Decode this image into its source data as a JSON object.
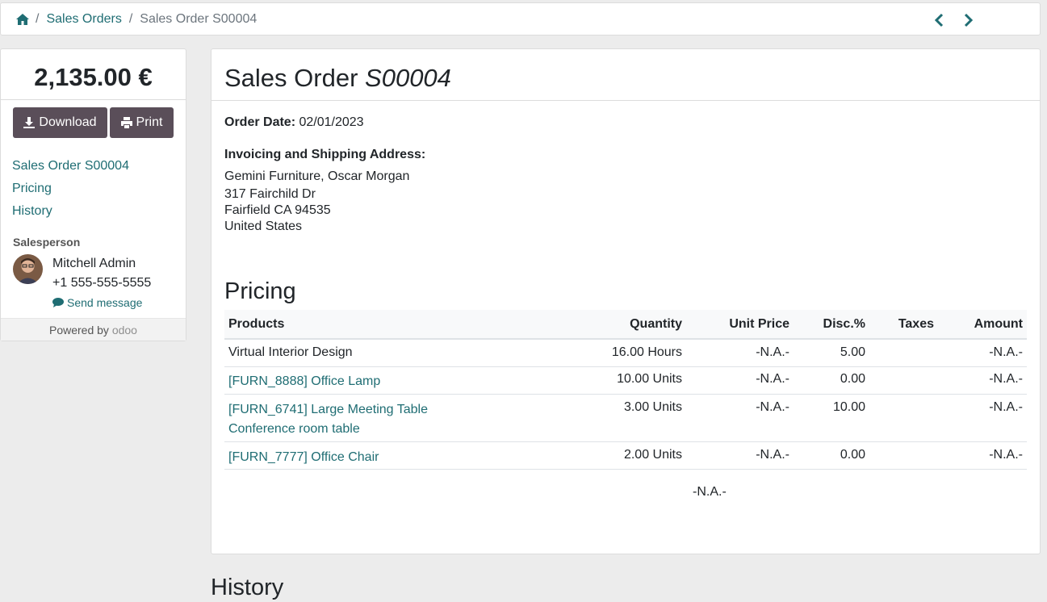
{
  "breadcrumb": {
    "home_icon": "home-icon",
    "separator": "/",
    "items": [
      "Sales Orders",
      "Sales Order S00004"
    ]
  },
  "pager": {
    "prev_icon": "chevron-left-icon",
    "next_icon": "chevron-right-icon"
  },
  "sidebar": {
    "total": "2,135.00 €",
    "download_label": "Download",
    "print_label": "Print",
    "nav": [
      "Sales Order S00004",
      "Pricing",
      "History"
    ],
    "salesperson_label": "Salesperson",
    "salesperson_name": "Mitchell Admin",
    "salesperson_phone": "+1 555-555-5555",
    "send_message": "Send message",
    "powered_by": "Powered by",
    "brand": "odoo"
  },
  "order": {
    "title_prefix": "Sales Order",
    "title_ref": "S00004",
    "date_label": "Order Date:",
    "date_value": "02/01/2023",
    "address_label": "Invoicing and Shipping Address:",
    "address_lines": [
      "Gemini Furniture, Oscar Morgan",
      "317 Fairchild Dr",
      "Fairfield CA 94535",
      "United States"
    ],
    "pricing_heading": "Pricing",
    "history_heading": "History"
  },
  "table": {
    "headers": [
      "Products",
      "Quantity",
      "Unit Price",
      "Disc.%",
      "Taxes",
      "Amount"
    ],
    "rows": [
      {
        "product": "Virtual Interior Design",
        "product_sub": "",
        "quantity": "16.00 Hours",
        "unit_price": "-N.A.-",
        "disc": "5.00",
        "taxes": "",
        "amount": "-N.A.-"
      },
      {
        "product": "[FURN_8888] Office Lamp",
        "product_sub": "",
        "quantity": "10.00 Units",
        "unit_price": "-N.A.-",
        "disc": "0.00",
        "taxes": "",
        "amount": "-N.A.-"
      },
      {
        "product": "[FURN_6741] Large Meeting Table",
        "product_sub": "Conference room table",
        "quantity": "3.00 Units",
        "unit_price": "-N.A.-",
        "disc": "10.00",
        "taxes": "",
        "amount": "-N.A.-"
      },
      {
        "product": "[FURN_7777] Office Chair",
        "product_sub": "",
        "quantity": "2.00 Units",
        "unit_price": "-N.A.-",
        "disc": "0.00",
        "taxes": "",
        "amount": "-N.A.-"
      }
    ],
    "footer_total": "-N.A.-"
  },
  "colors": {
    "link": "#1f6d73",
    "button": "#5a4e59",
    "background": "#ececec"
  }
}
